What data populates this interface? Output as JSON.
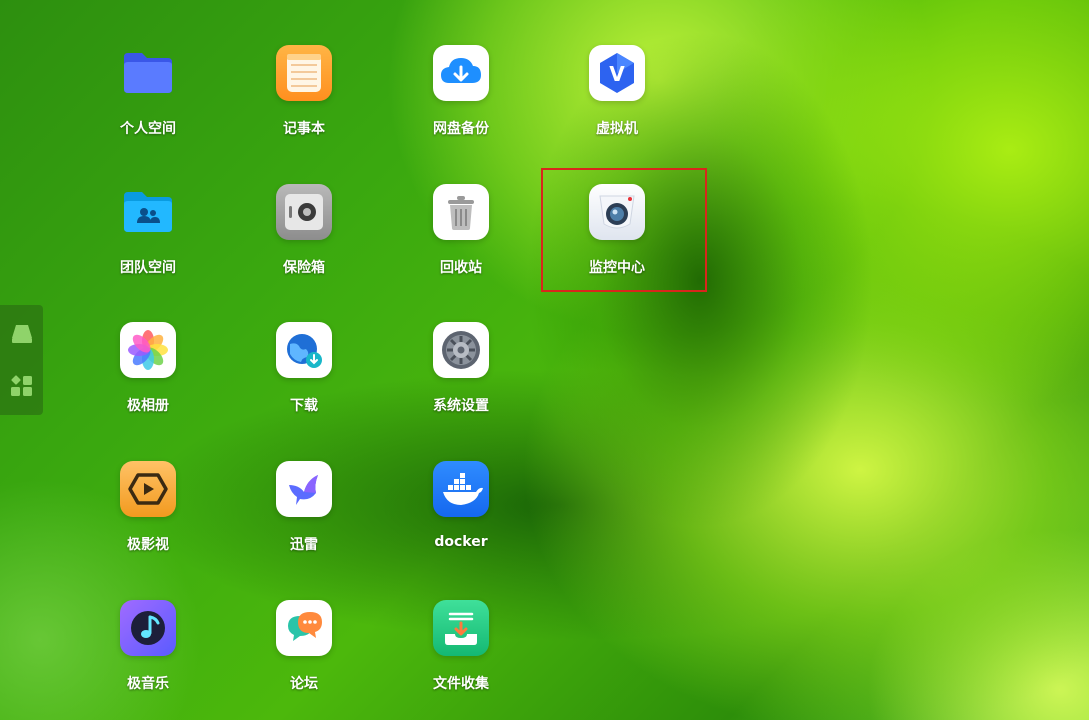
{
  "apps": [
    {
      "id": "personal-space",
      "label": "个人空间",
      "icon": "folder-icon"
    },
    {
      "id": "notepad",
      "label": "记事本",
      "icon": "notepad-icon"
    },
    {
      "id": "cloud-backup",
      "label": "网盘备份",
      "icon": "cloud-download-icon"
    },
    {
      "id": "virtual-machine",
      "label": "虚拟机",
      "icon": "v-hexagon-icon"
    },
    {
      "id": "team-space",
      "label": "团队空间",
      "icon": "team-folder-icon"
    },
    {
      "id": "safe-box",
      "label": "保险箱",
      "icon": "safe-icon"
    },
    {
      "id": "recycle-bin",
      "label": "回收站",
      "icon": "trash-icon"
    },
    {
      "id": "monitor-center",
      "label": "监控中心",
      "icon": "camera-icon",
      "selected": true
    },
    {
      "id": "photo-album",
      "label": "极相册",
      "icon": "photos-flower-icon"
    },
    {
      "id": "download",
      "label": "下载",
      "icon": "globe-download-icon"
    },
    {
      "id": "settings",
      "label": "系统设置",
      "icon": "gear-icon"
    },
    {
      "id": "video",
      "label": "极影视",
      "icon": "video-play-icon"
    },
    {
      "id": "thunder",
      "label": "迅雷",
      "icon": "bird-icon"
    },
    {
      "id": "docker",
      "label": "docker",
      "icon": "docker-whale-icon"
    },
    {
      "id": "music",
      "label": "极音乐",
      "icon": "music-note-icon"
    },
    {
      "id": "forum",
      "label": "论坛",
      "icon": "chat-bubbles-icon"
    },
    {
      "id": "file-collect",
      "label": "文件收集",
      "icon": "inbox-tray-icon"
    }
  ],
  "dock": {
    "items": [
      {
        "id": "drive",
        "icon": "drive-icon"
      },
      {
        "id": "apps",
        "icon": "app-grid-icon"
      }
    ]
  },
  "colors": {
    "selection": "#d9261c",
    "label": "#ffffff"
  }
}
